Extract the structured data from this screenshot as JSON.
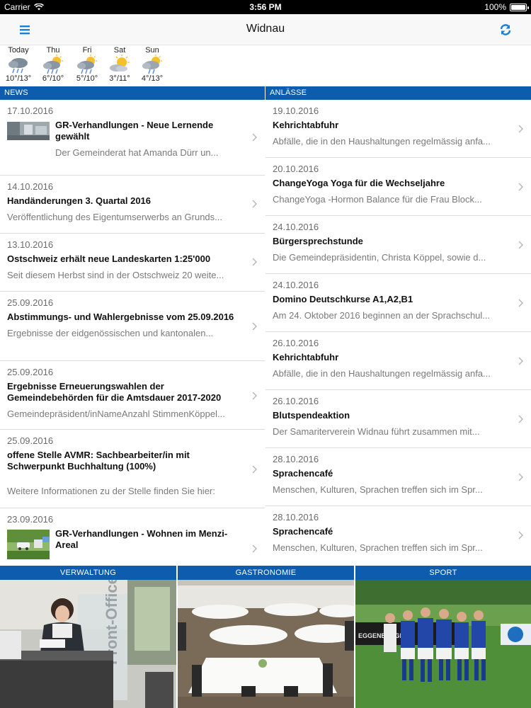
{
  "statusbar": {
    "carrier": "Carrier",
    "time": "3:56 PM",
    "battery": "100%"
  },
  "navbar": {
    "title": "Widnau",
    "menu_icon": "hamburger-menu-icon",
    "refresh_icon": "refresh-icon"
  },
  "weather": [
    {
      "day": "Today",
      "temp": "10°/13°",
      "icon": "cloud-rain-icon"
    },
    {
      "day": "Thu",
      "temp": "6°/10°",
      "icon": "sun-cloud-rain-icon"
    },
    {
      "day": "Fri",
      "temp": "5°/10°",
      "icon": "sun-cloud-rain-icon"
    },
    {
      "day": "Sat",
      "temp": "3°/11°",
      "icon": "sun-cloud-icon"
    },
    {
      "day": "Sun",
      "temp": "4°/13°",
      "icon": "sun-cloud-rain-icon"
    }
  ],
  "news": {
    "header": "NEWS",
    "items": [
      {
        "date": "17.10.2016",
        "title": "GR-Verhandlungen - Neue Lernende gewählt",
        "desc": "Der Gemeinderat hat Amanda Dürr un..."
      },
      {
        "date": "14.10.2016",
        "title": "Handänderungen 3. Quartal 2016",
        "desc": "Veröffentlichung des Eigentumserwerbs an Grunds..."
      },
      {
        "date": "13.10.2016",
        "title": "Ostschweiz erhält neue Landeskarten 1:25'000",
        "desc": "Seit diesem Herbst sind in der Ostschweiz 20 weite..."
      },
      {
        "date": "25.09.2016",
        "title": "Abstimmungs- und Wahlergebnisse vom 25.09.2016",
        "desc": "Ergebnisse der eidgenössischen und kantonalen..."
      },
      {
        "date": "25.09.2016",
        "title": "Ergebnisse Erneuerungswahlen der Gemeindebehörden für die Amtsdauer 2017-2020",
        "desc": "Gemeindepräsident/inNameAnzahl StimmenKöppel..."
      },
      {
        "date": "25.09.2016",
        "title": "offene Stelle AVMR: Sachbearbeiter/in mit Schwerpunkt Buchhaltung (100%)",
        "desc": "Weitere Informationen zu der Stelle finden Sie hier:"
      },
      {
        "date": "23.09.2016",
        "title": "GR-Verhandlungen - Wohnen im Menzi-Areal",
        "desc": ""
      }
    ]
  },
  "events": {
    "header": "ANLÄSSE",
    "items": [
      {
        "date": "19.10.2016",
        "title": "Kehrichtabfuhr",
        "desc": "Abfälle, die in den Haushaltungen regelmässig anfa..."
      },
      {
        "date": "20.10.2016",
        "title": "ChangeYoga Yoga für die Wechseljahre",
        "desc": "ChangeYoga -Hormon Balance für die Frau  Block..."
      },
      {
        "date": "24.10.2016",
        "title": "Bürgersprechstunde",
        "desc": "Die Gemeindepräsidentin, Christa Köppel, sowie d..."
      },
      {
        "date": "24.10.2016",
        "title": "Domino Deutschkurse A1,A2,B1",
        "desc": "Am 24. Oktober 2016 beginnen an der Sprachschul..."
      },
      {
        "date": "26.10.2016",
        "title": "Kehrichtabfuhr",
        "desc": "Abfälle, die in den Haushaltungen regelmässig anfa..."
      },
      {
        "date": "26.10.2016",
        "title": "Blutspendeaktion",
        "desc": "Der Samariterverein Widnau führt zusammen mit..."
      },
      {
        "date": "28.10.2016",
        "title": "Sprachencafé",
        "desc": "Menschen, Kulturen, Sprachen treffen sich im Spr..."
      },
      {
        "date": "28.10.2016",
        "title": "Sprachencafé",
        "desc": "Menschen, Kulturen, Sprachen treffen sich im Spr..."
      }
    ]
  },
  "tiles": [
    {
      "label": "VERWALTUNG",
      "image": "front-office-reception-photo",
      "sign": "Front-Office"
    },
    {
      "label": "GASTRONOMIE",
      "image": "banquet-hall-photo"
    },
    {
      "label": "SPORT",
      "image": "football-team-photo",
      "sign": "EGGENBERGER"
    }
  ],
  "colors": {
    "accent": "#0e5cad",
    "nav_bg": "#f8f8f8",
    "separator": "#dcdcdc"
  }
}
